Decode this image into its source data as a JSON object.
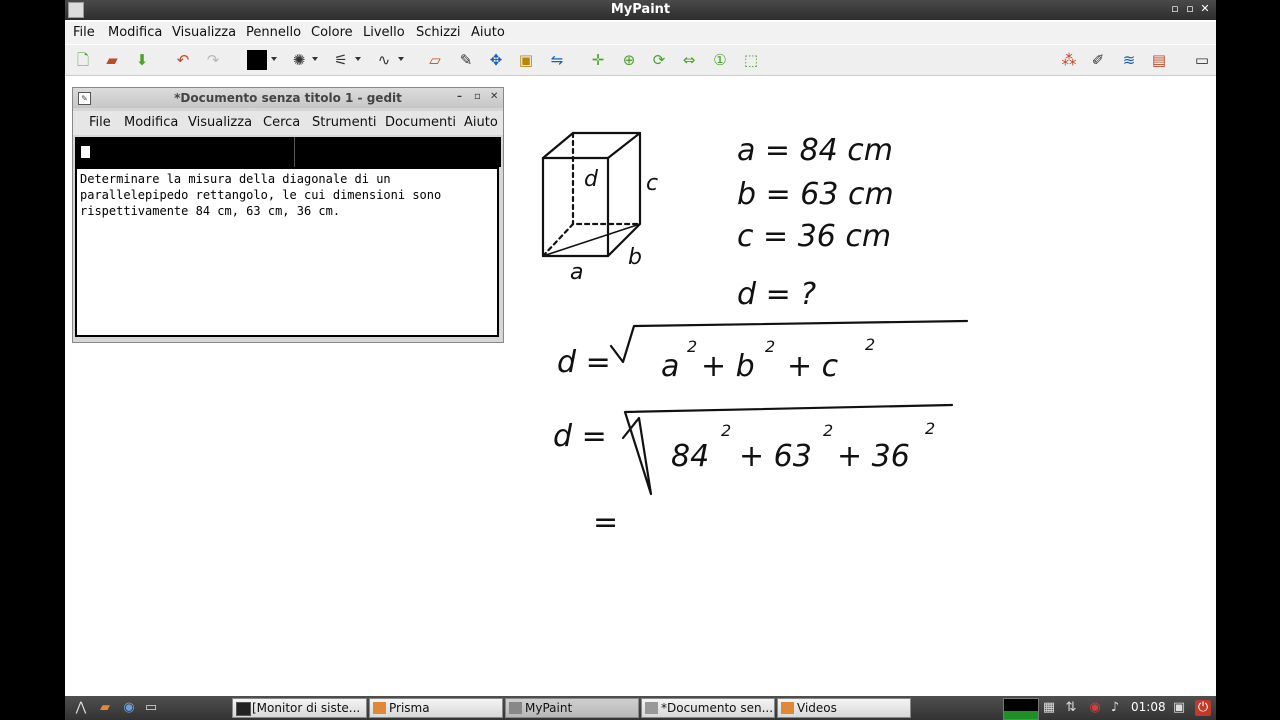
{
  "window": {
    "title": "MyPaint"
  },
  "menu": [
    "File",
    "Modifica",
    "Visualizza",
    "Pennello",
    "Colore",
    "Livello",
    "Schizzi",
    "Aiuto"
  ],
  "toolbar_icons": [
    "new-file-icon",
    "open-folder-icon",
    "save-icon",
    "undo-icon",
    "redo-icon",
    "color-swatch",
    "brush-presets-icon",
    "brush-settings-icon",
    "stroke-icon",
    "eraser-icon",
    "color-picker-icon",
    "move-icon",
    "frame-icon",
    "symmetry-icon",
    "pan-icon",
    "zoom-icon",
    "rotate-icon",
    "mirror-icon",
    "reset-view-icon",
    "fit-view-icon",
    "layers-icon",
    "brush-icon",
    "layer-stack-icon",
    "scratchpad-icon",
    "fullscreen-icon"
  ],
  "gedit": {
    "title": "*Documento senza titolo 1 - gedit",
    "menu": [
      "File",
      "Modifica",
      "Visualizza",
      "Cerca",
      "Strumenti",
      "Documenti",
      "Aiuto"
    ],
    "text_lines": [
      "Determinare la misura della diagonale di un",
      "parallelepipedo rettangolo, le cui dimensioni sono",
      "rispettivamente 84 cm, 63 cm, 36 cm."
    ]
  },
  "drawing": {
    "box_labels": {
      "a": "a",
      "b": "b",
      "c": "c",
      "d": "d"
    },
    "given": [
      "a = 84 cm",
      "b = 63 cm",
      "c = 36 cm"
    ],
    "unknown": "d = ?",
    "formula": {
      "lhs": "d =",
      "radicand": [
        "a",
        "+ b",
        "+ c"
      ],
      "exp": "2"
    },
    "substitution": {
      "lhs": "d =",
      "radicand": [
        "84",
        "+ 63",
        "+ 36"
      ],
      "exp": "2"
    },
    "result_start": "="
  },
  "taskbar": {
    "tasks": [
      "[Monitor di siste...",
      "Prisma",
      "MyPaint",
      "*Documento sen...",
      "Videos"
    ],
    "clock": "01:08"
  }
}
